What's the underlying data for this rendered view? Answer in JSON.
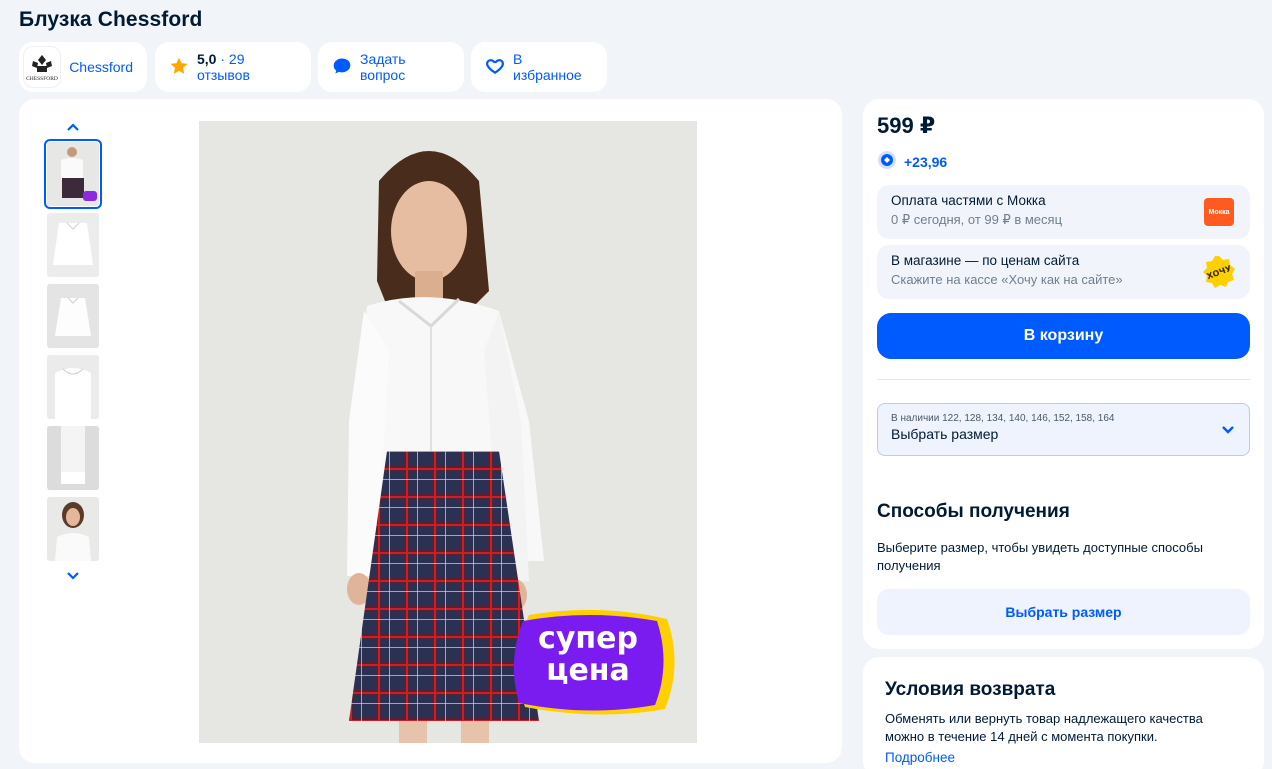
{
  "product": {
    "title": "Блузка Chessford"
  },
  "header": {
    "brand_name": "Chessford",
    "brand_logo_text": "CHESSFORD",
    "rating": "5,0",
    "reviews": "· 29 отзывов",
    "ask_question": "Задать вопрос",
    "favorite": "В избранное"
  },
  "gallery": {
    "promo_line1": "супер",
    "promo_line2": "цена",
    "thumb_count": 6
  },
  "buy": {
    "price": "599 ₽",
    "bonus": "+23,96",
    "installments_title": "Оплата частями с Мокка",
    "installments_sub": "0 ₽ сегодня, от 99 ₽ в месяц",
    "installments_badge": "Мокка",
    "store_title": "В магазине — по ценам сайта",
    "store_sub": "Скажите на кассе «Хочу как на сайте»",
    "store_badge": "ХОЧУ",
    "cart_button": "В корзину",
    "size_available": "В наличии 122, 128, 134, 140, 146, 152, 158, 164",
    "size_placeholder": "Выбрать размер"
  },
  "delivery": {
    "title": "Способы получения",
    "text": "Выберите размер, чтобы увидеть доступные способы получения",
    "button": "Выбрать размер"
  },
  "returns": {
    "title": "Условия возврата",
    "text": "Обменять или вернуть товар надлежащего качества можно в течение 14 дней с момента покупки.",
    "link": "Подробнее"
  },
  "colors": {
    "accent": "#005bff",
    "promo_purple": "#7a1cf0",
    "promo_yellow": "#ffd000",
    "mokka_orange": "#ff5a1f"
  }
}
